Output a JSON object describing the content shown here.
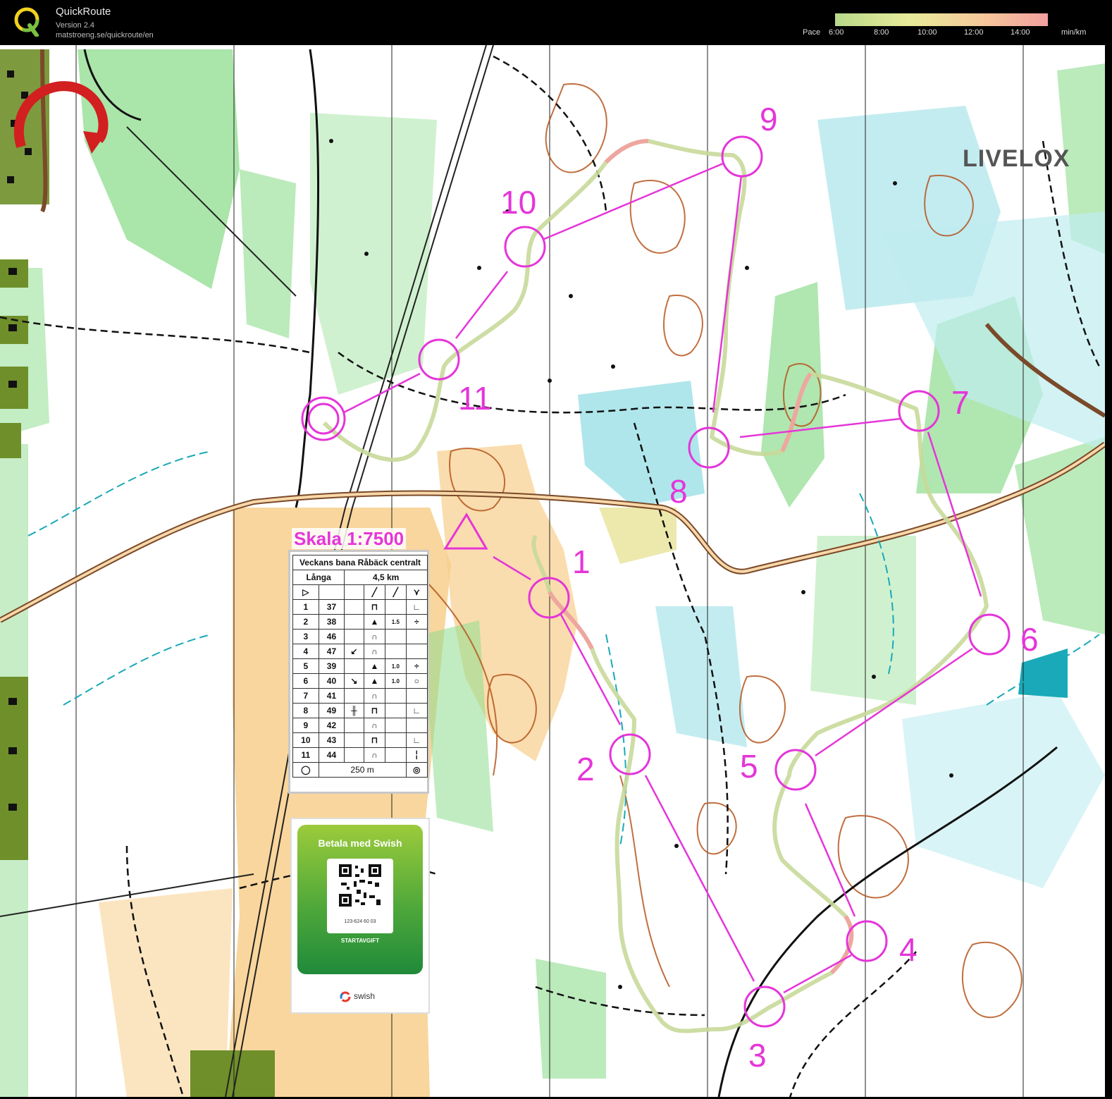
{
  "app": {
    "name": "QuickRoute",
    "version": "Version 2.4",
    "url": "matstroeng.se/quickroute/en"
  },
  "pace": {
    "label": "Pace",
    "ticks": [
      "6:00",
      "8:00",
      "10:00",
      "12:00",
      "14:00"
    ],
    "unit": "min/km"
  },
  "map": {
    "scale_label": "Skala 1:7500",
    "control_numbers": [
      "1",
      "2",
      "3",
      "4",
      "5",
      "6",
      "7",
      "8",
      "9",
      "10",
      "11"
    ],
    "livelox_text": "LIVELOX"
  },
  "description_sheet": {
    "title": "Veckans bana Råbäck centralt",
    "course": "Långa",
    "length": "4,5 km",
    "rows": [
      {
        "n": "1",
        "code": "37"
      },
      {
        "n": "2",
        "code": "38"
      },
      {
        "n": "3",
        "code": "46"
      },
      {
        "n": "4",
        "code": "47"
      },
      {
        "n": "5",
        "code": "39"
      },
      {
        "n": "6",
        "code": "40"
      },
      {
        "n": "7",
        "code": "41"
      },
      {
        "n": "8",
        "code": "49"
      },
      {
        "n": "9",
        "code": "42"
      },
      {
        "n": "10",
        "code": "43"
      },
      {
        "n": "11",
        "code": "44"
      }
    ],
    "finish": "250 m",
    "notes_2": "1.5",
    "notes_5": "1.0",
    "notes_6": "1.0"
  },
  "swish": {
    "title": "Betala med Swish",
    "number": "123-624 60 03",
    "subtitle": "STARTAVGIFT",
    "brand": "swish"
  },
  "colors": {
    "course": "#e535d9",
    "forest": "#ffffff",
    "green": "#7bd67b",
    "open": "#f8cf8c",
    "marsh": "#2fb5c2",
    "contour": "#b5561f"
  }
}
